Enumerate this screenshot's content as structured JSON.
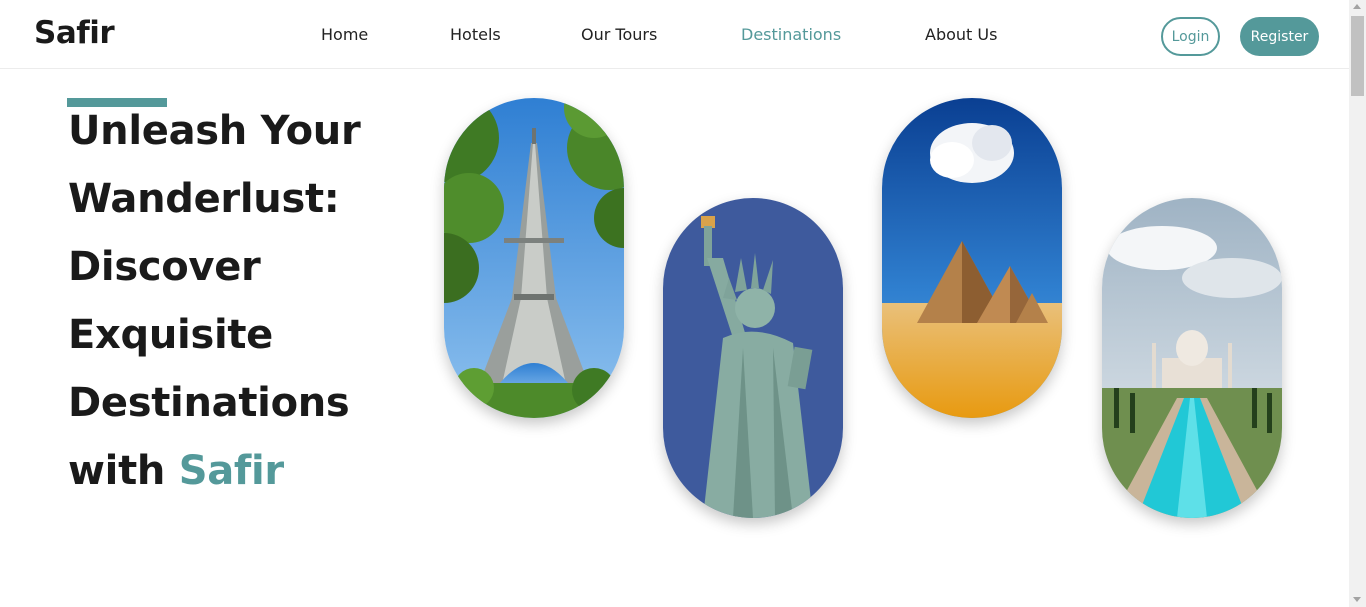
{
  "header": {
    "logo": "Safir",
    "nav": [
      "Home",
      "Hotels",
      "Our Tours",
      "Destinations",
      "About Us"
    ],
    "active_nav": "Destinations",
    "login_label": "Login",
    "register_label": "Register"
  },
  "hero": {
    "headline_lines": [
      "Unleash Your",
      "Wanderlust:",
      "Discover",
      "Exquisite",
      "Destinations"
    ],
    "last_line_prefix": "with",
    "brand_word": "Safir"
  },
  "colors": {
    "accent": "#54999a",
    "text": "#1a1a1a"
  }
}
